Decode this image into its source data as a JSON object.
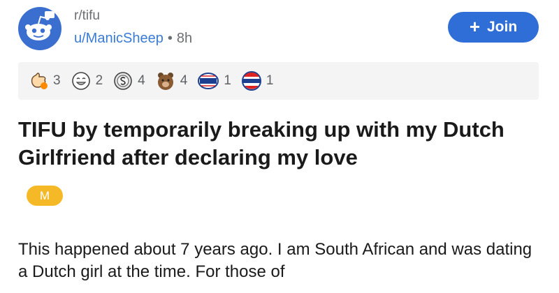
{
  "post": {
    "subreddit": "r/tifu",
    "author": "u/ManicSheep",
    "separator": "•",
    "age": "8h",
    "join_label": "Join",
    "join_icon": "+",
    "title": "TIFU by temporarily breaking up with my Dutch Girlfriend after declaring my love",
    "flair": "M",
    "body": "This happened about 7 years ago. I am South African and was dating a Dutch girl at the time. For those of"
  },
  "awards": [
    {
      "icon": "wholesome-award-icon",
      "count": "3"
    },
    {
      "icon": "laughing-face-award-icon",
      "count": "2"
    },
    {
      "icon": "silver-coin-award-icon",
      "count": "4"
    },
    {
      "icon": "bear-award-icon",
      "count": "4"
    },
    {
      "icon": "voted-sticker-award-icon",
      "count": "1"
    },
    {
      "icon": "vote-badge-award-icon",
      "count": "1"
    }
  ],
  "colors": {
    "join_button": "#2f6ed6",
    "author_link": "#3a7bd5",
    "flair": "#f5b928",
    "avatar": "#3a6fd0"
  }
}
